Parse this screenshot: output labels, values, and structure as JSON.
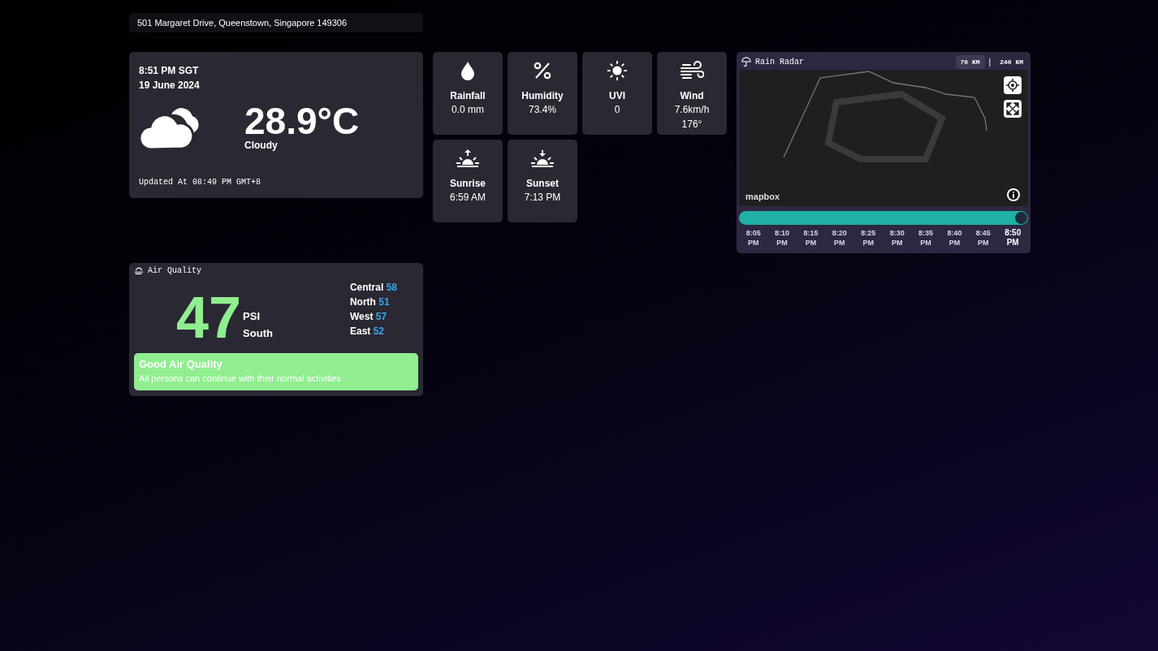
{
  "address": "501 Margaret Drive, Queenstown, Singapore 149306",
  "current": {
    "time": "8:51 PM SGT",
    "date": "19 June 2024",
    "temperature": "28.9°C",
    "condition": "Cloudy",
    "updated": "Updated At 08:49 PM GMT+8"
  },
  "tiles": [
    {
      "kind": "rain",
      "label": "Rainfall",
      "values": [
        "0.0 mm"
      ]
    },
    {
      "kind": "humidity",
      "label": "Humidity",
      "values": [
        "73.4%"
      ]
    },
    {
      "kind": "uvi",
      "label": "UVI",
      "values": [
        "0"
      ]
    },
    {
      "kind": "wind",
      "label": "Wind",
      "values": [
        "7.6km/h",
        "176°"
      ]
    },
    {
      "kind": "sunrise",
      "label": "Sunrise",
      "values": [
        "6:59 AM"
      ]
    },
    {
      "kind": "sunset",
      "label": "Sunset",
      "values": [
        "7:13 PM"
      ]
    }
  ],
  "radar": {
    "title": "Rain Radar",
    "ranges": [
      {
        "label": "70 KM",
        "selected": true
      },
      {
        "label": "240 KM",
        "selected": false
      }
    ],
    "separator": "|",
    "logo": "mapbox",
    "level": 1,
    "times": [
      {
        "time": "8:05",
        "period": "PM",
        "selected": false
      },
      {
        "time": "8:10",
        "period": "PM",
        "selected": false
      },
      {
        "time": "8:15",
        "period": "PM",
        "selected": false
      },
      {
        "time": "8:20",
        "period": "PM",
        "selected": false
      },
      {
        "time": "8:25",
        "period": "PM",
        "selected": false
      },
      {
        "time": "8:30",
        "period": "PM",
        "selected": false
      },
      {
        "time": "8:35",
        "period": "PM",
        "selected": false
      },
      {
        "time": "8:40",
        "period": "PM",
        "selected": false
      },
      {
        "time": "8:45",
        "period": "PM",
        "selected": false
      },
      {
        "time": "8:50",
        "period": "PM",
        "selected": true
      }
    ]
  },
  "air_quality": {
    "title": "Air Quality",
    "psi": "47",
    "unit": "PSI",
    "region": "South",
    "color": "#90ee90",
    "regions": [
      {
        "name": "Central",
        "value": "58"
      },
      {
        "name": "North",
        "value": "51"
      },
      {
        "name": "West",
        "value": "57"
      },
      {
        "name": "East",
        "value": "52"
      }
    ],
    "status": {
      "title": "Good Air Quality",
      "description": "All persons can continue with their normal activities"
    }
  }
}
